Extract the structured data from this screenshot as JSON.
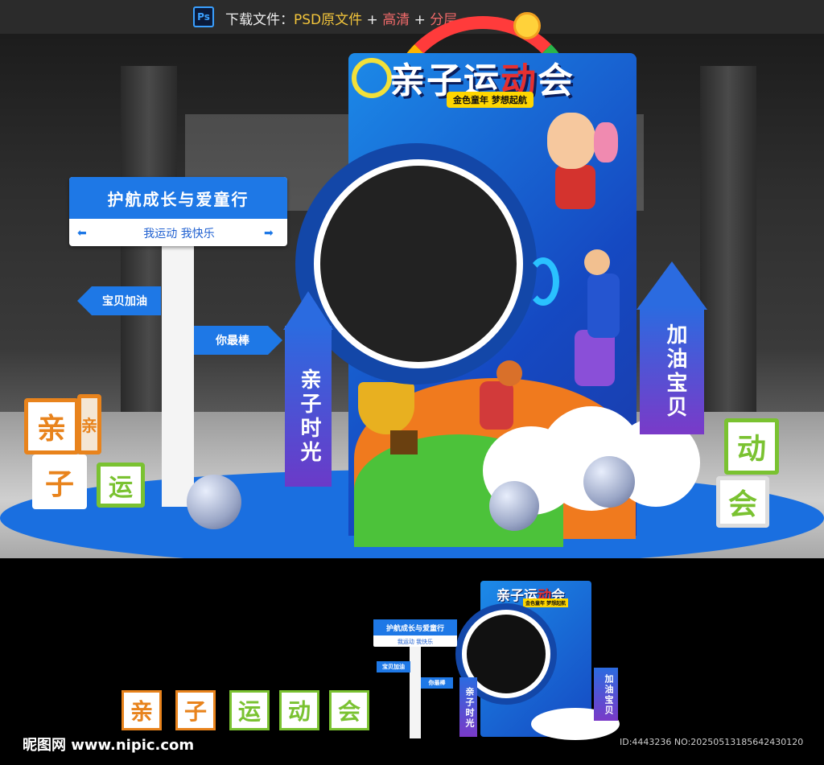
{
  "topbar": {
    "ps_label": "Ps",
    "prefix": "下载文件：",
    "psd": "PSD原文件",
    "plus1": " + ",
    "hd": "高清",
    "plus2": " + ",
    "layers": "分层"
  },
  "board": {
    "title_a": "亲子运",
    "title_b": "动",
    "title_c": "会",
    "subtitle": "金色童年 梦想起航"
  },
  "sign": {
    "title": "护航成长与爱童行",
    "subtitle": "我运动 我快乐",
    "left_arrow": "⬅",
    "right_arrow": "➡",
    "tag_left": "宝贝加油",
    "tag_right": "你最棒"
  },
  "pillars": {
    "left": "亲子时光",
    "right": "加油宝贝"
  },
  "cubes": {
    "c1": "亲",
    "c1_side": "亲",
    "c2": "子",
    "c3": "运",
    "c4": "动",
    "c5": "会"
  },
  "bottom": {
    "blocks": [
      "亲",
      "子",
      "运",
      "动",
      "会"
    ],
    "block_colors": [
      "#e8831c",
      "#e8831c",
      "#7ac231",
      "#7ac231",
      "#7ac231"
    ],
    "brand": "昵图网 www.nipic.com",
    "image_id": "ID:4443236 NO:20250513185642430120"
  },
  "colors": {
    "accent_blue": "#1e78e6",
    "orange": "#e8831c",
    "green": "#7ac231"
  }
}
